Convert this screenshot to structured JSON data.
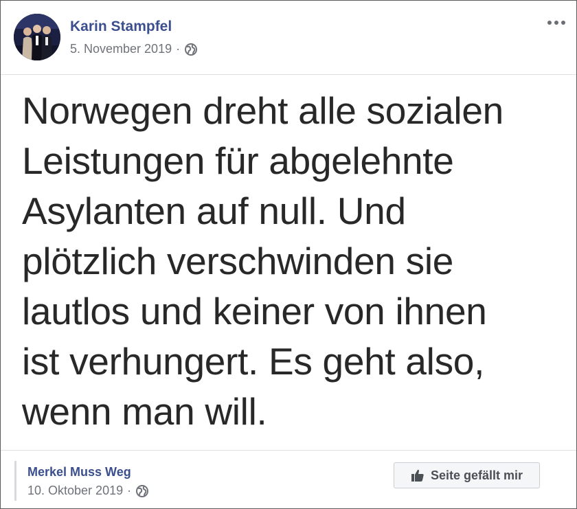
{
  "post": {
    "author": "Karin Stampfel",
    "date": "5. November 2019",
    "separator": "·",
    "privacy_icon": "globe-icon",
    "more_icon": "more-options-icon",
    "text_lines": [
      "Norwegen dreht alle sozialen",
      "Leistungen für abgelehnte",
      "Asylanten auf null. Und",
      "plötzlich verschwinden sie",
      "lautlos und keiner von ihnen",
      "ist verhungert. Es geht also,",
      "wenn man will."
    ]
  },
  "shared_page": {
    "name": "Merkel Muss Weg",
    "date": "10. Oktober 2019",
    "separator": "·",
    "privacy_icon": "globe-icon",
    "like_button_label": "Seite gefällt mir",
    "like_icon": "thumbs-up-icon"
  },
  "colors": {
    "link": "#3b4f8f",
    "meta": "#6f7278",
    "text": "#282828",
    "button_bg": "#f5f6f7"
  }
}
